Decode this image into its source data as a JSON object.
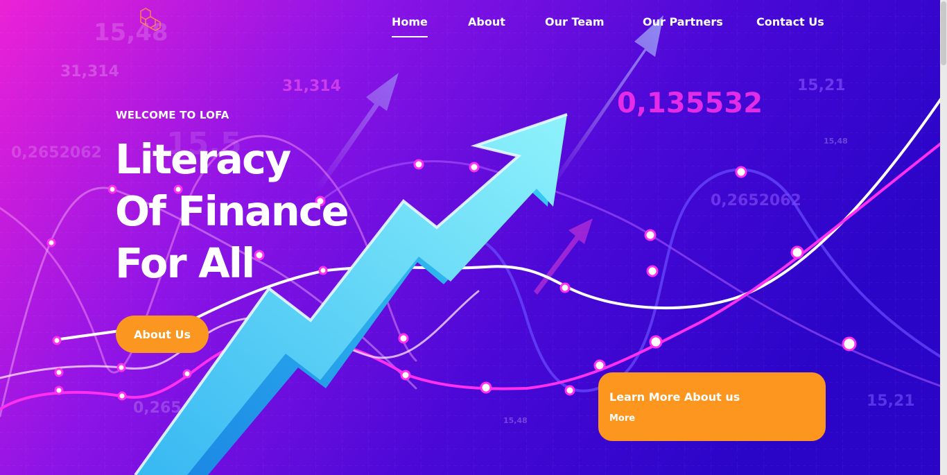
{
  "nav": {
    "items": [
      {
        "label": "Home",
        "active": true
      },
      {
        "label": "About",
        "active": false
      },
      {
        "label": "Our Team",
        "active": false
      },
      {
        "label": "Our Partners",
        "active": false
      },
      {
        "label": "Contact Us",
        "active": false
      }
    ]
  },
  "hero": {
    "welcome": "WELCOME TO LOFA",
    "headline_lines": [
      "Literacy",
      "Of Finance",
      "For All"
    ],
    "cta_label": "About Us"
  },
  "card": {
    "title": "Learn More About us",
    "link_label": "More"
  },
  "background_numbers": [
    "15,48",
    "31,314",
    "31,314",
    "0,2652062",
    "15,5",
    "0,135532",
    "15,21",
    "15,48",
    "0,2652062",
    "0,265",
    "15,48",
    "15,21"
  ],
  "colors": {
    "accent_orange": "#fd961e",
    "bg_pink": "#e51fd9",
    "bg_purple": "#7a12e8",
    "bg_blue": "#2f06d0",
    "arrow_cyan": "#5fdcf6"
  }
}
